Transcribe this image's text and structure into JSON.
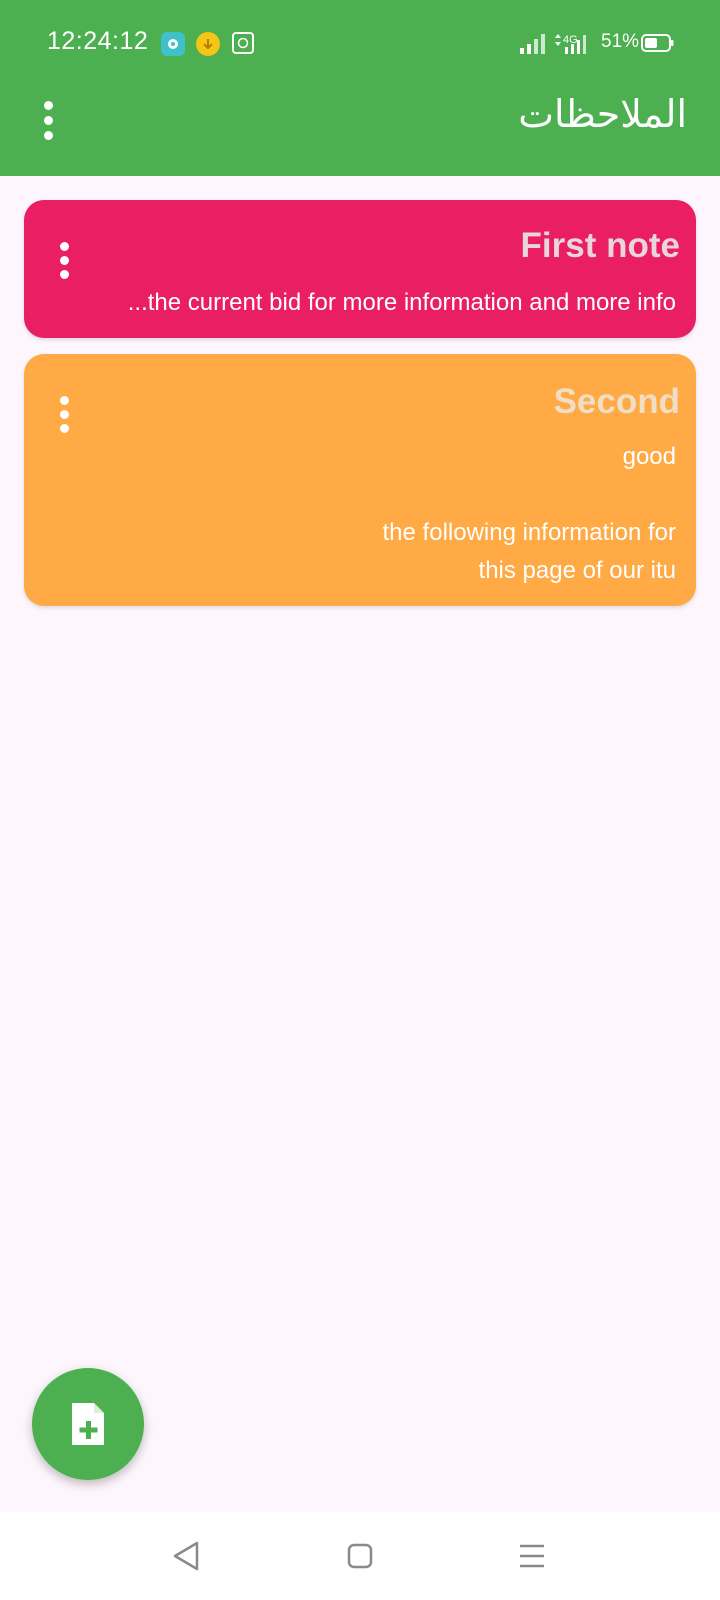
{
  "status_bar": {
    "time": "12:24:12",
    "network": "4G",
    "battery": "51%"
  },
  "app_bar": {
    "title": "الملاحظات"
  },
  "notes": [
    {
      "title": "First note",
      "body": "...the current bid for more information and more info",
      "color": "#e91e63"
    },
    {
      "title": "Second",
      "body": "good\n\nthe following information for\nthis page of our itu",
      "color": "#ffaa44"
    }
  ],
  "icons": {
    "app_menu": "more-vert-icon",
    "note_menu": "more-vert-icon",
    "fab": "note-add-icon",
    "nav": [
      "back-icon",
      "home-icon",
      "recents-icon"
    ]
  },
  "colors": {
    "primary": "#4caf50",
    "background": "#fdf6fd"
  }
}
